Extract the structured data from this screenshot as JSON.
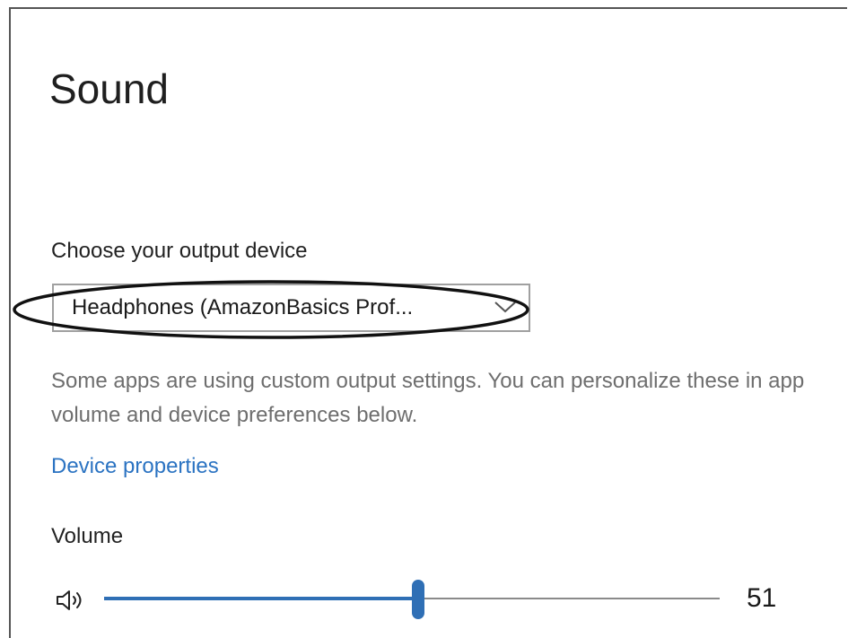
{
  "page": {
    "title": "Sound"
  },
  "output": {
    "label": "Choose your output device",
    "selected_device": "Headphones (AmazonBasics Prof...",
    "description": "Some apps are using custom output settings. You can personalize these in app volume and device preferences below.",
    "device_properties_link": "Device properties"
  },
  "volume": {
    "label": "Volume",
    "value": "51",
    "level_fraction": 0.51,
    "icon": "speaker-icon"
  },
  "colors": {
    "accent": "#2f6fb5",
    "link": "#2b73c2",
    "secondary_text": "#6e6e6e"
  }
}
